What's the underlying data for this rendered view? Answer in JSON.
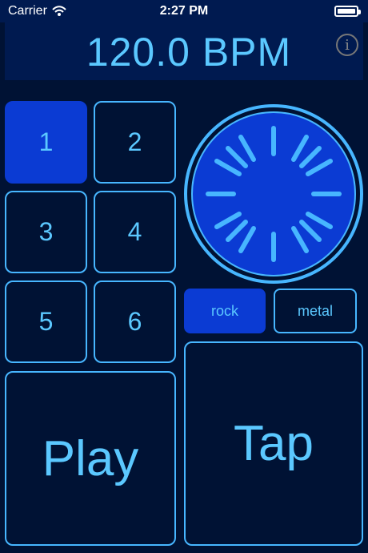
{
  "status_bar": {
    "carrier": "Carrier",
    "time": "2:27 PM",
    "wifi_icon": "wifi-icon",
    "battery_icon": "battery-icon"
  },
  "header": {
    "bpm": "120.0 BPM",
    "info_icon": "info-icon",
    "info_glyph": "i"
  },
  "pads": [
    {
      "label": "1",
      "selected": true
    },
    {
      "label": "2",
      "selected": false
    },
    {
      "label": "3",
      "selected": false
    },
    {
      "label": "4",
      "selected": false
    },
    {
      "label": "5",
      "selected": false
    },
    {
      "label": "6",
      "selected": false
    }
  ],
  "styles": [
    {
      "label": "rock",
      "selected": true
    },
    {
      "label": "metal",
      "selected": false
    }
  ],
  "buttons": {
    "play": "Play",
    "tap": "Tap"
  },
  "colors": {
    "background": "#001234",
    "panel": "#001a50",
    "accent_line": "#47b6ff",
    "text": "#5bc8ff",
    "active": "#0b3bd3"
  },
  "dial": {
    "icon": "tempo-dial-icon",
    "tick_count": 12
  }
}
